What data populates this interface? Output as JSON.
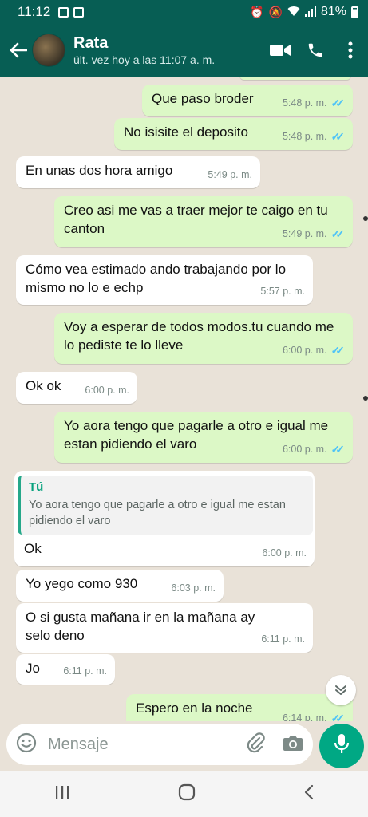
{
  "status_bar": {
    "time": "11:12",
    "battery": "81%"
  },
  "header": {
    "contact_name": "Rata",
    "last_seen": "últ. vez hoy a las 11:07 a. m.",
    "icons": [
      "back-arrow-icon",
      "video-call-icon",
      "phone-icon",
      "more-options-icon"
    ]
  },
  "messages": [
    {
      "dir": "out",
      "text": "Que paso broder",
      "time": "5:48 p. m."
    },
    {
      "dir": "out",
      "text": "No isisite el deposito",
      "time": "5:48 p. m."
    },
    {
      "dir": "in",
      "text": "En unas dos hora amigo",
      "time": "5:49 p. m."
    },
    {
      "dir": "out",
      "text": "Creo asi me vas a traer mejor te caigo en tu canton",
      "time": "5:49 p. m."
    },
    {
      "dir": "in",
      "text": "Cómo vea estimado ando trabajando por lo mismo no lo e echp",
      "time": "5:57 p. m."
    },
    {
      "dir": "out",
      "text": "Voy a esperar de todos modos.tu cuando me lo pediste te lo lleve",
      "time": "6:00 p. m."
    },
    {
      "dir": "in",
      "text": "Ok ok",
      "time": "6:00 p. m."
    },
    {
      "dir": "out",
      "text": "Yo aora tengo que pagarle a otro e igual me estan pidiendo el varo",
      "time": "6:00 p. m."
    },
    {
      "dir": "in",
      "text": "Ok",
      "time": "6:00 p. m.",
      "reply": {
        "author": "Tú",
        "text": "Yo aora tengo que pagarle a otro e igual me estan pidiendo el varo"
      }
    },
    {
      "dir": "in",
      "text": "Yo yego como 930",
      "time": "6:03 p. m."
    },
    {
      "dir": "in",
      "text": "O si gusta mañana ir en la mañana ay selo deno",
      "time": "6:11 p. m."
    },
    {
      "dir": "in",
      "text": "Jo",
      "time": "6:11 p. m."
    },
    {
      "dir": "out",
      "text": "Espero en la noche",
      "time": "6:14 p. m."
    }
  ],
  "composer": {
    "placeholder": "Mensaje"
  },
  "colors": {
    "header": "#075e54",
    "outgoing_bubble": "#dcf8c6",
    "incoming_bubble": "#ffffff",
    "read_ticks": "#4fc3f7",
    "accent": "#00a884"
  }
}
